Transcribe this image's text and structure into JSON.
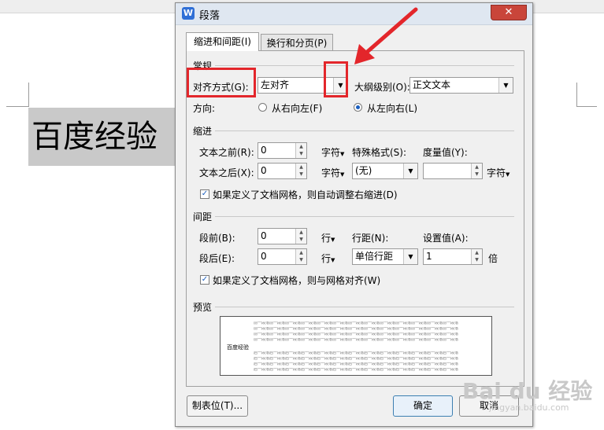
{
  "document": {
    "text": "百度经验"
  },
  "dialog": {
    "title": "段落",
    "app_icon": "W",
    "close_label": "✕",
    "tabs": [
      {
        "label": "缩进和间距(I)",
        "active": true
      },
      {
        "label": "换行和分页(P)",
        "active": false
      }
    ],
    "general": {
      "section_title": "常规",
      "alignment_label": "对齐方式(G):",
      "alignment_value": "左对齐",
      "outline_label": "大纲级别(O):",
      "outline_value": "正文文本",
      "direction_label": "方向:",
      "direction_rtl": "从右向左(F)",
      "direction_ltr": "从左向右(L)"
    },
    "indent": {
      "section_title": "缩进",
      "before_label": "文本之前(R):",
      "before_value": "0",
      "before_unit": "字符",
      "after_label": "文本之后(X):",
      "after_value": "0",
      "after_unit": "字符",
      "special_label": "特殊格式(S):",
      "special_value": "(无)",
      "measure_label": "度量值(Y):",
      "measure_value": "",
      "measure_unit": "字符",
      "auto_adjust_label": "如果定义了文档网格，则自动调整右缩进(D)"
    },
    "spacing": {
      "section_title": "间距",
      "before_label": "段前(B):",
      "before_value": "0",
      "before_unit": "行",
      "after_label": "段后(E):",
      "after_value": "0",
      "after_unit": "行",
      "line_spacing_label": "行距(N):",
      "line_spacing_value": "单倍行距",
      "setting_label": "设置值(A):",
      "setting_value": "1",
      "setting_unit": "倍",
      "snap_grid_label": "如果定义了文档网格，则与网格对齐(W)"
    },
    "preview": {
      "section_title": "预览",
      "filler": "前一段落前一段落前一段落前一段落前一段落前一段落前一段落前一段落前一段落前一段落前一段落前一段落前一段落",
      "following": "后一段落后一段落后一段落后一段落后一段落后一段落后一段落后一段落后一段落后一段落后一段落后一段落后一段落",
      "sample": "百度经验"
    },
    "buttons": {
      "tabs": "制表位(T)...",
      "ok": "确定",
      "cancel": "取消"
    }
  },
  "watermark": {
    "main": "Bai du 经验",
    "sub": "jingyan.baidu.com"
  },
  "colors": {
    "highlight_red": "#e3262b",
    "accent_blue": "#1b5fbf"
  }
}
